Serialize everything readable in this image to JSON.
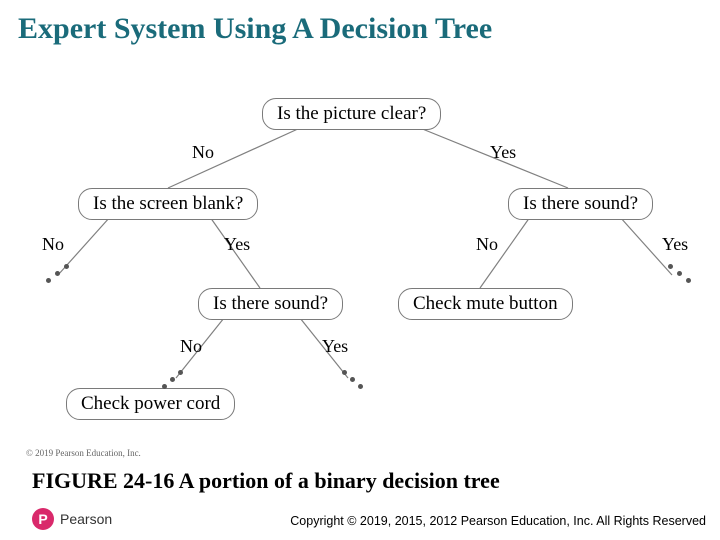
{
  "title": "Expert System Using A Decision Tree",
  "nodes": {
    "root": "Is the picture clear?",
    "blank": "Is the screen blank?",
    "soundR": "Is there sound?",
    "soundL": "Is there sound?",
    "mute": "Check mute button",
    "power": "Check power cord"
  },
  "labels": {
    "no": "No",
    "yes": "Yes"
  },
  "caption": "FIGURE 24-16 A portion of a binary decision tree",
  "srccredit": "© 2019 Pearson Education, Inc.",
  "footer": "Copyright © 2019, 2015, 2012 Pearson Education, Inc. All Rights Reserved",
  "brand": "Pearson"
}
